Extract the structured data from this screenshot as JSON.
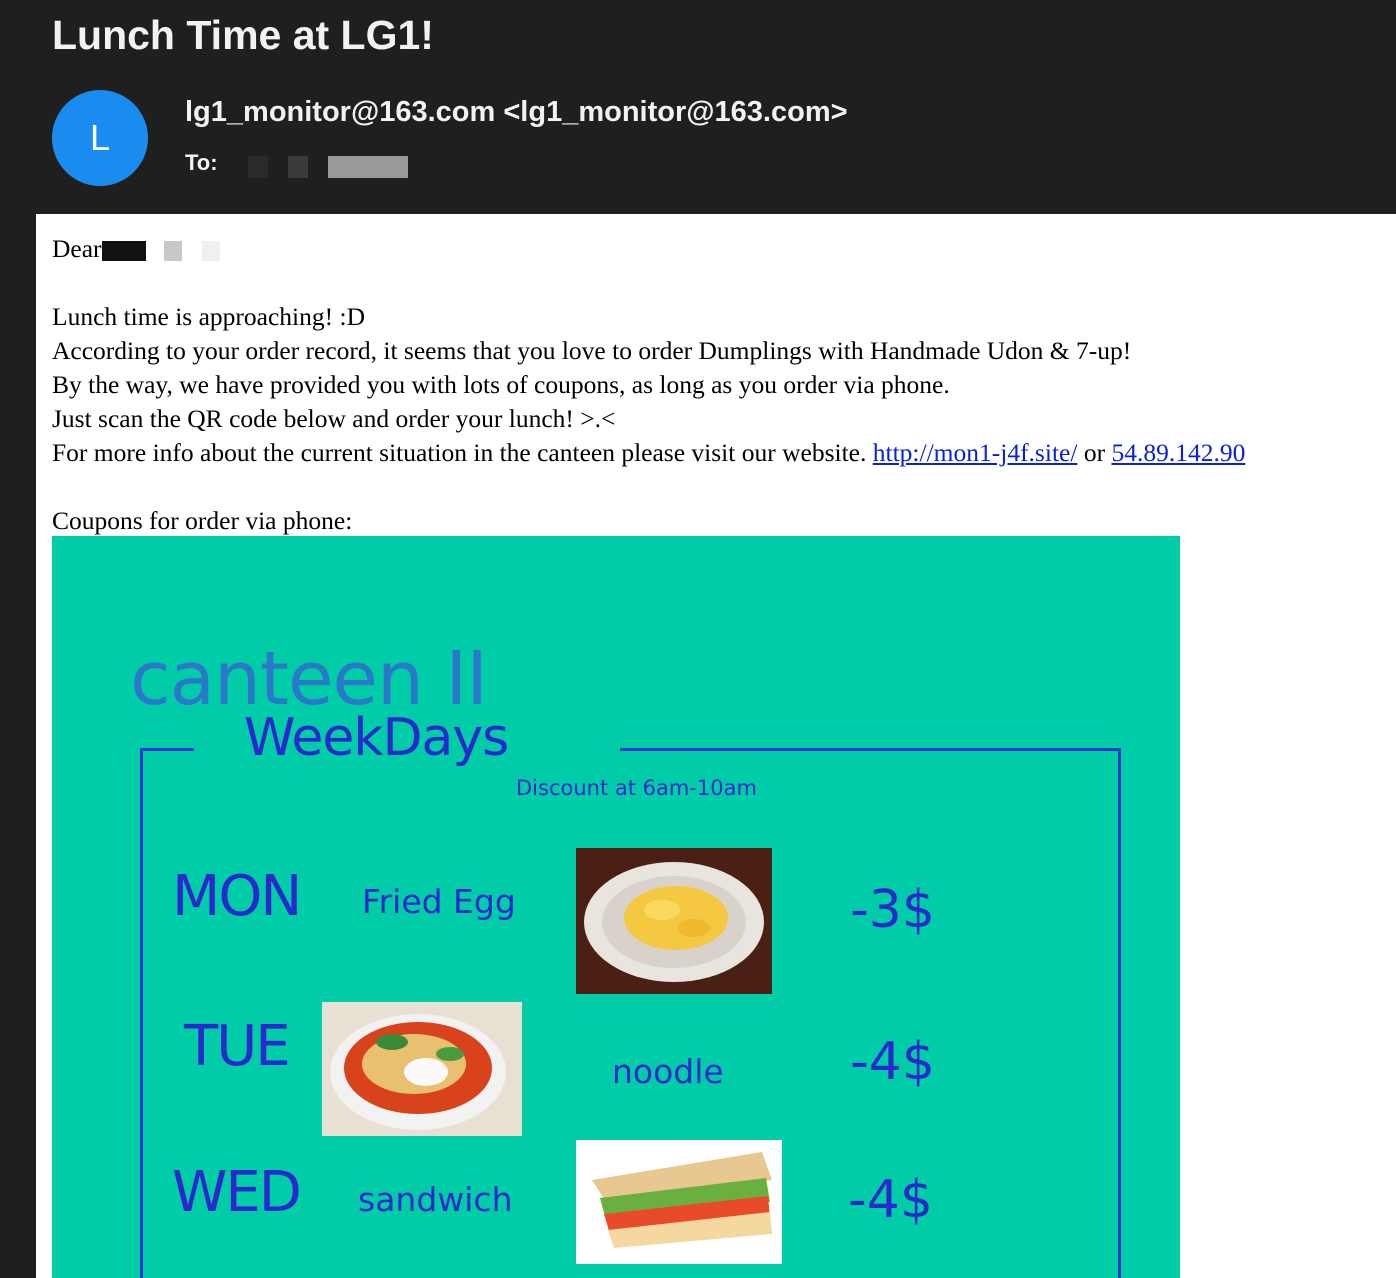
{
  "email": {
    "subject": "Lunch Time at LG1!",
    "avatar_letter": "L",
    "from": "lg1_monitor@163.com <lg1_monitor@163.com>",
    "to_label": "To:"
  },
  "body": {
    "greeting": "Dear",
    "line1": "Lunch time is approaching! :D",
    "line2": "According to your order record, it seems that you love to order Dumplings with Handmade Udon & 7-up!",
    "line3": "By the way, we have provided you with lots of coupons, as long as you order via phone.",
    "line4": "Just scan the QR code below and order your lunch! >.<",
    "line5_prefix": "For more info about the current situation in the canteen please visit our website.",
    "link1": "http://mon1-j4f.site/",
    "link_sep": "or",
    "link2": "54.89.142.90",
    "coupons_label": "Coupons for order via phone:"
  },
  "coupon": {
    "title": "canteen II",
    "subtitle": "WeekDays",
    "discount_note": "Discount at 6am-10am",
    "rows": [
      {
        "day": "MON",
        "food": "Fried Egg",
        "price": "-3$"
      },
      {
        "day": "TUE",
        "food": "noodle",
        "price": "-4$"
      },
      {
        "day": "WED",
        "food": "sandwich",
        "price": "-4$"
      }
    ]
  },
  "colors": {
    "header_bg": "#1f1f1f",
    "avatar": "#1a8cf0",
    "coupon_bg": "#00cca8",
    "coupon_text": "#2a2acc",
    "link": "#0b21d6"
  }
}
